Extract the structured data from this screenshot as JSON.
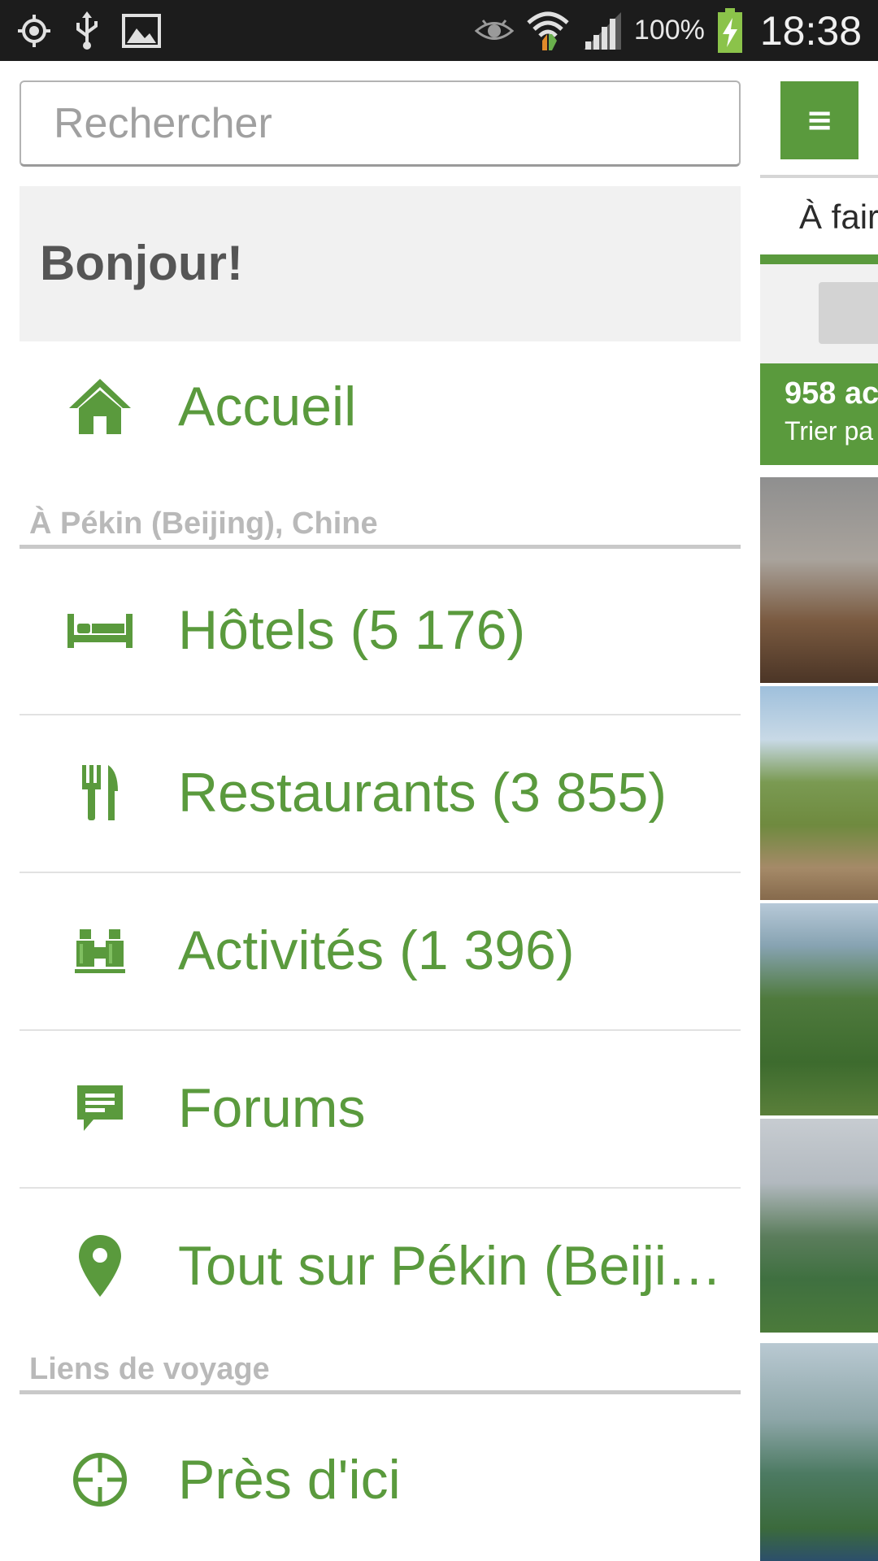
{
  "status_bar": {
    "battery_percent": "100%",
    "time": "18:38",
    "icons": [
      "gps-icon",
      "usb-icon",
      "image-icon",
      "eye-icon",
      "wifi-icon",
      "signal-icon",
      "battery-charging-icon"
    ]
  },
  "drawer": {
    "search": {
      "placeholder": "Rechercher"
    },
    "greeting": "Bonjour!",
    "home": {
      "label": "Accueil",
      "icon": "home-icon"
    },
    "section_city": "À Pékin (Beijing), Chine",
    "items": [
      {
        "label": "Hôtels (5 176)",
        "icon": "bed-icon"
      },
      {
        "label": "Restaurants (3 855)",
        "icon": "fork-knife-icon"
      },
      {
        "label": "Activités (1 396)",
        "icon": "binoculars-icon"
      },
      {
        "label": "Forums",
        "icon": "chat-icon"
      },
      {
        "label": "Tout sur Pékin (Beiji…",
        "icon": "map-pin-icon"
      }
    ],
    "section_travel": "Liens de voyage",
    "nearby": {
      "label": "Près d'ici",
      "icon": "crosshair-icon"
    }
  },
  "background": {
    "menu_button_icon": "menu-icon",
    "tab_label": "À fair",
    "count_title": "958 ac",
    "sort_label": "Trier pa"
  },
  "colors": {
    "accent": "#5a9a3d",
    "status_bar": "#1c1c1c",
    "section_text": "#b9b9b9",
    "greeting_bg": "#f1f1f1"
  }
}
